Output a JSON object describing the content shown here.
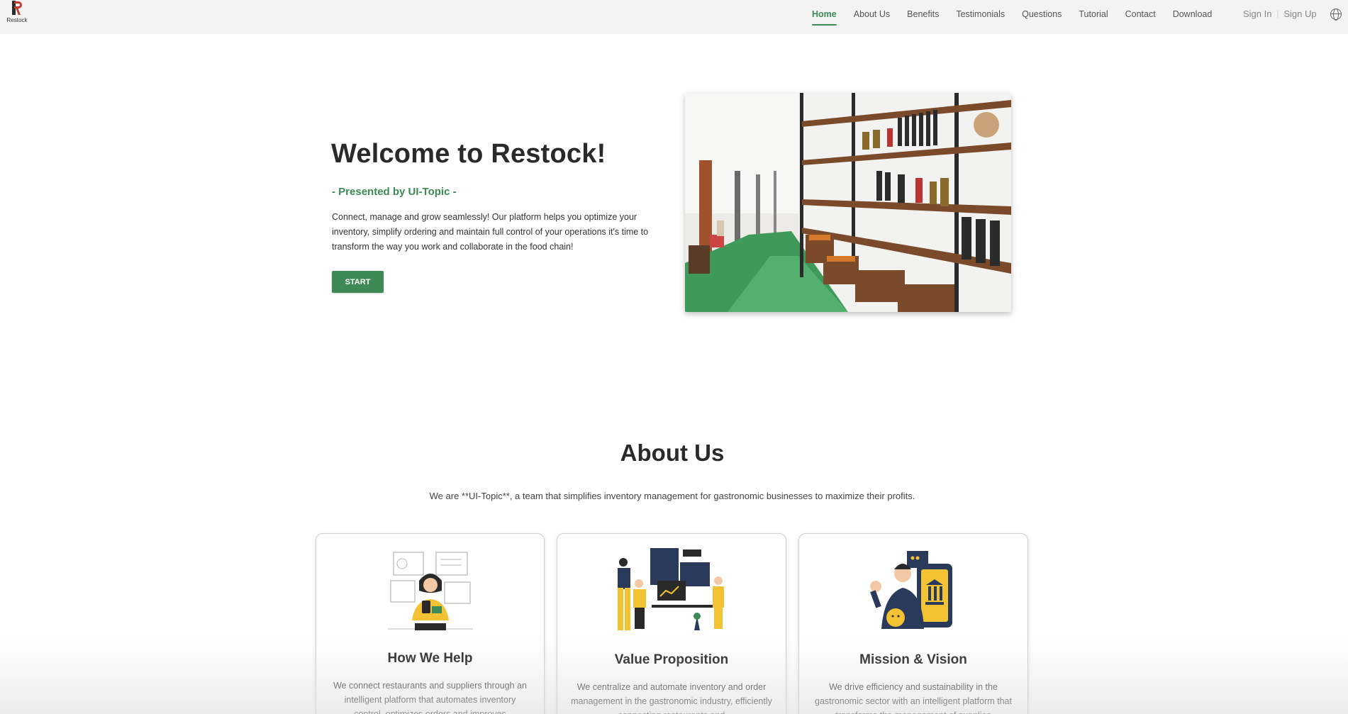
{
  "brand": {
    "logo_text": "Restock"
  },
  "nav": {
    "items": [
      {
        "label": "Home",
        "active": true
      },
      {
        "label": "About Us"
      },
      {
        "label": "Benefits"
      },
      {
        "label": "Testimonials"
      },
      {
        "label": "Questions"
      },
      {
        "label": "Tutorial"
      },
      {
        "label": "Contact"
      },
      {
        "label": "Download"
      }
    ],
    "sign_in": "Sign In",
    "sign_up": "Sign Up",
    "separator": "|",
    "language_icon": "globe-icon"
  },
  "hero": {
    "title": "Welcome to Restock!",
    "subtitle": "- Presented by UI-Topic -",
    "description": "Connect, manage and grow seamlessly! Our platform helps you optimize your inventory, simplify ordering and maintain full control of your operations it's time to transform the way you work and collaborate in the food chain!",
    "start_label": "START",
    "image": "grocery-store-shelves-photo"
  },
  "about": {
    "title": "About Us",
    "description": "We are **UI-Topic**, a team that simplifies inventory management for gastronomic businesses to maximize their profits.",
    "cards": [
      {
        "title": "How We Help",
        "text": "We connect restaurants and suppliers through an intelligent platform that automates inventory control, optimizes orders and improves",
        "illustration": "woman-with-phone-dashboard-illustration"
      },
      {
        "title": "Value Proposition",
        "text": "We centralize and automate inventory and order management in the gastronomic industry, efficiently connecting restaurants and",
        "illustration": "team-analytics-illustration"
      },
      {
        "title": "Mission & Vision",
        "text": "We drive efficiency and sustainability in the gastronomic sector with an intelligent platform that transforms the management of supplies",
        "illustration": "man-with-mobile-bank-illustration"
      }
    ]
  },
  "colors": {
    "accent": "#3c8a55",
    "button": "#3e8a57",
    "nav_bg": "#f3f3f3"
  }
}
